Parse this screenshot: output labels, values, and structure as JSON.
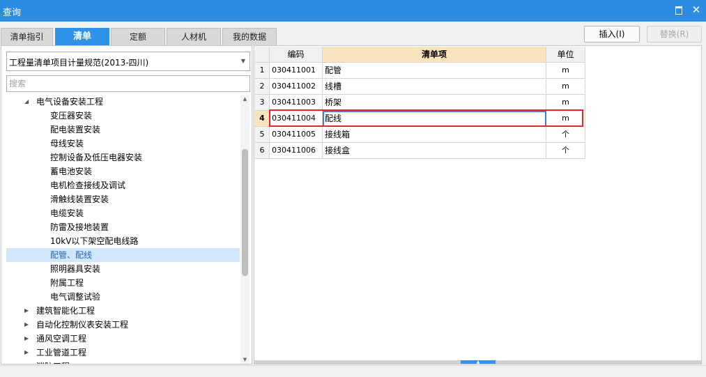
{
  "window": {
    "title": "查询"
  },
  "tabs": [
    {
      "label": "清单指引",
      "active": false
    },
    {
      "label": "清单",
      "active": true
    },
    {
      "label": "定额",
      "active": false
    },
    {
      "label": "人材机",
      "active": false
    },
    {
      "label": "我的数据",
      "active": false
    }
  ],
  "buttons": {
    "insert": "插入(I)",
    "replace": "替换(R)"
  },
  "left": {
    "spec_select": "工程量清单项目计量规范(2013-四川)",
    "search_placeholder": "搜索",
    "tree": [
      {
        "label": "电气设备安装工程",
        "level": 1,
        "expanded": true
      },
      {
        "label": "变压器安装",
        "level": 2
      },
      {
        "label": "配电装置安装",
        "level": 2
      },
      {
        "label": "母线安装",
        "level": 2
      },
      {
        "label": "控制设备及低压电器安装",
        "level": 2
      },
      {
        "label": "蓄电池安装",
        "level": 2
      },
      {
        "label": "电机检查接线及调试",
        "level": 2
      },
      {
        "label": "滑触线装置安装",
        "level": 2
      },
      {
        "label": "电缆安装",
        "level": 2
      },
      {
        "label": "防雷及接地装置",
        "level": 2
      },
      {
        "label": "10kV以下架空配电线路",
        "level": 2
      },
      {
        "label": "配管、配线",
        "level": 2,
        "selected": true
      },
      {
        "label": "照明器具安装",
        "level": 2
      },
      {
        "label": "附属工程",
        "level": 2
      },
      {
        "label": "电气调整试验",
        "level": 2
      },
      {
        "label": "建筑智能化工程",
        "level": 1,
        "expanded": false
      },
      {
        "label": "自动化控制仪表安装工程",
        "level": 1,
        "expanded": false
      },
      {
        "label": "通风空调工程",
        "level": 1,
        "expanded": false
      },
      {
        "label": "工业管道工程",
        "level": 1,
        "expanded": false
      },
      {
        "label": "消防工程",
        "level": 1,
        "expanded": false
      }
    ]
  },
  "table": {
    "columns": [
      "编码",
      "清单项",
      "单位"
    ],
    "rows": [
      {
        "num": "1",
        "code": "030411001",
        "name": "配管",
        "unit": "m"
      },
      {
        "num": "2",
        "code": "030411002",
        "name": "线槽",
        "unit": "m"
      },
      {
        "num": "3",
        "code": "030411003",
        "name": "桥架",
        "unit": "m"
      },
      {
        "num": "4",
        "code": "030411004",
        "name": "配线",
        "unit": "m",
        "current": true
      },
      {
        "num": "5",
        "code": "030411005",
        "name": "接线箱",
        "unit": "个"
      },
      {
        "num": "6",
        "code": "030411006",
        "name": "接线盒",
        "unit": "个"
      }
    ]
  },
  "colors": {
    "accent": "#2c8ce3",
    "selection": "#cfe6fb",
    "highlight_border": "#e3262c",
    "header_highlight": "#fbe3c0"
  },
  "icons": {
    "restore": "restore-icon",
    "close": "close-icon",
    "dropdown": "chevron-down-icon",
    "expand": "triangle-icon"
  }
}
